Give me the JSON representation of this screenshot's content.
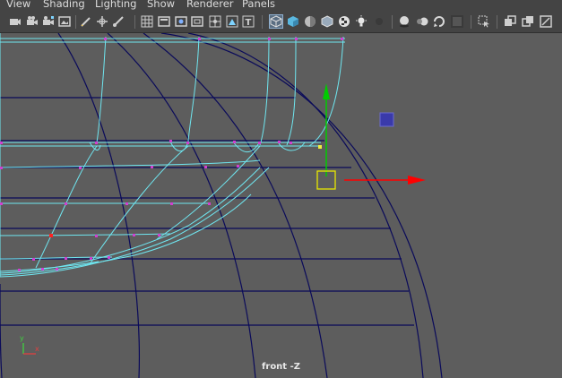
{
  "menu": {
    "items": [
      {
        "label": "View"
      },
      {
        "label": "Shading"
      },
      {
        "label": "Lighting"
      },
      {
        "label": "Show"
      },
      {
        "label": "Renderer"
      },
      {
        "label": "Panels"
      }
    ]
  },
  "toolbar": {
    "icons": [
      "select-camera-icon",
      "camera-attributes-icon",
      "bookmarks-icon",
      "image-plane-icon",
      "grease-pencil-icon",
      "2d-pan-zoom-icon",
      "film-gate-icon",
      "resolution-gate-icon",
      "grid-icon",
      "field-chart-icon",
      "safe-action-icon",
      "safe-title-icon",
      "wireframe-icon",
      "smooth-shade-icon",
      "textured-icon",
      "wireframe-on-shaded-icon",
      "checker-icon",
      "use-all-lights-icon",
      "shadows-icon",
      "ambient-occlusion-icon",
      "motion-blur-icon",
      "anti-aliasing-icon",
      "isolate-select-icon",
      "x-ray-icon",
      "x-ray-joints-icon",
      "backface-culling-icon"
    ]
  },
  "viewport": {
    "camera_label": "front -Z",
    "axis_y_label": "y",
    "axis_x_label": "x",
    "colors": {
      "background": "#5d5d5d",
      "wireframe_sphere": "#0a0a5a",
      "selected_mesh": "#6fe6f0",
      "vertex": "#d040d0",
      "manipulator_x": "#ff0000",
      "manipulator_y": "#00cc00",
      "manipulator_center": "#e8e800",
      "manipulator_plane": "#3a3aaa"
    }
  }
}
